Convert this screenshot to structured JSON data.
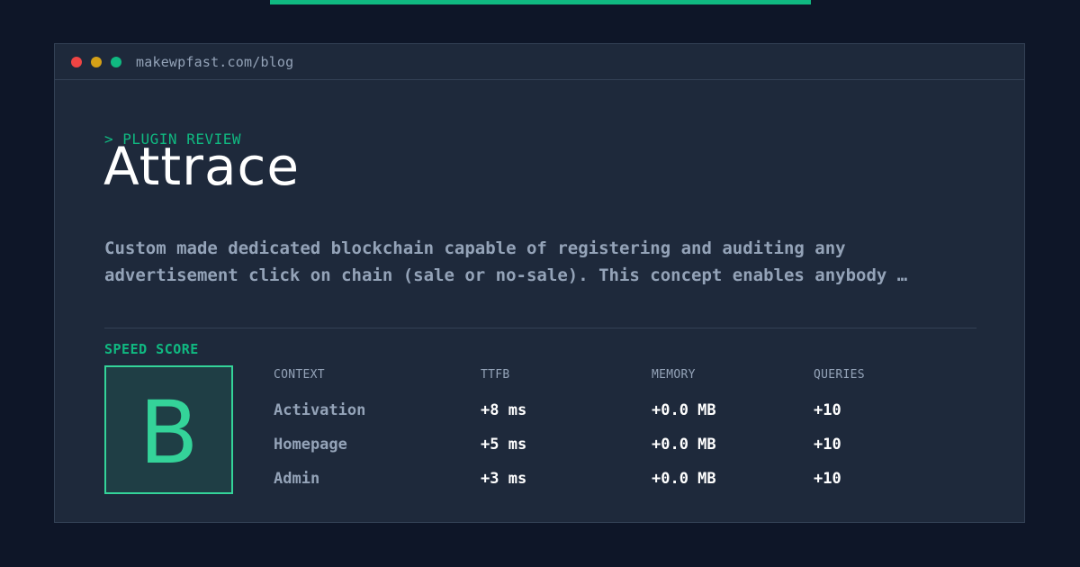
{
  "window": {
    "url": "makewpfast.com/blog"
  },
  "article": {
    "eyebrow": "> PLUGIN REVIEW",
    "title": "Attrace",
    "description": "Custom made dedicated blockchain capable of registering and auditing any advertisement click on chain (sale or no-sale). This concept enables anybody …"
  },
  "speed": {
    "label": "SPEED SCORE",
    "grade": "B"
  },
  "table": {
    "headers": [
      "CONTEXT",
      "TTFB",
      "MEMORY",
      "QUERIES"
    ],
    "rows": [
      [
        "Activation",
        "+8 ms",
        "+0.0 MB",
        "+10"
      ],
      [
        "Homepage",
        "+5 ms",
        "+0.0 MB",
        "+10"
      ],
      [
        "Admin",
        "+3 ms",
        "+0.0 MB",
        "+10"
      ]
    ]
  },
  "colors": {
    "background": "#0e1628",
    "window": "#1e293b",
    "accent": "#10b981",
    "grade": "#34d399",
    "muted": "#94a3b8",
    "close_dot": "#ef4444",
    "minimize_dot": "#d4a017",
    "maximize_dot": "#10b981"
  }
}
